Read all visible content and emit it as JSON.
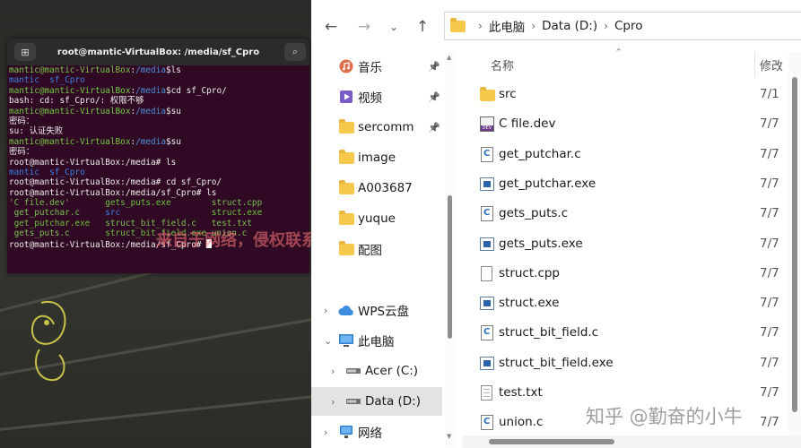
{
  "terminal": {
    "title": "root@mantic-VirtualBox: /media/sf_Cpro",
    "lines": [
      [
        {
          "t": "mantic@mantic-VirtualBox",
          "c": "p-user"
        },
        {
          "t": ":",
          "c": ""
        },
        {
          "t": "/media",
          "c": "p-path"
        },
        {
          "t": "$ls",
          "c": ""
        }
      ],
      [
        {
          "t": "mantic  sf_Cpro",
          "c": "dirc"
        }
      ],
      [
        {
          "t": "mantic@mantic-VirtualBox",
          "c": "p-user"
        },
        {
          "t": ":",
          "c": ""
        },
        {
          "t": "/media",
          "c": "p-path"
        },
        {
          "t": "$cd sf_Cpro/",
          "c": ""
        }
      ],
      [
        {
          "t": "bash: cd: sf_Cpro/: 权限不够",
          "c": ""
        }
      ],
      [
        {
          "t": "mantic@mantic-VirtualBox",
          "c": "p-user"
        },
        {
          "t": ":",
          "c": ""
        },
        {
          "t": "/media",
          "c": "p-path"
        },
        {
          "t": "$su",
          "c": ""
        }
      ],
      [
        {
          "t": "密码：",
          "c": ""
        }
      ],
      [
        {
          "t": "su: 认证失败",
          "c": ""
        }
      ],
      [
        {
          "t": "mantic@mantic-VirtualBox",
          "c": "p-user"
        },
        {
          "t": ":",
          "c": ""
        },
        {
          "t": "/media",
          "c": "p-path"
        },
        {
          "t": "$su",
          "c": ""
        }
      ],
      [
        {
          "t": "密码：",
          "c": ""
        }
      ],
      [
        {
          "t": "root@mantic-VirtualBox:/media# ls",
          "c": ""
        }
      ],
      [
        {
          "t": "mantic  sf_Cpro",
          "c": "dirc"
        }
      ],
      [
        {
          "t": "root@mantic-VirtualBox:/media# cd sf_Cpro/",
          "c": ""
        }
      ],
      [
        {
          "t": "root@mantic-VirtualBox:/media/sf_Cpro# ls",
          "c": ""
        }
      ],
      [
        {
          "t": "'C file.dev'       ",
          "c": "src"
        },
        {
          "t": "gets_puts.exe        ",
          "c": "exec"
        },
        {
          "t": "struct.cpp",
          "c": "src"
        }
      ],
      [
        {
          "t": " get_putchar.c     ",
          "c": "src"
        },
        {
          "t": "src                  ",
          "c": "dirc"
        },
        {
          "t": "struct.exe",
          "c": "exec"
        }
      ],
      [
        {
          "t": " get_putchar.exe   ",
          "c": "exec"
        },
        {
          "t": "struct_bit_field.c   ",
          "c": "src"
        },
        {
          "t": "test.txt",
          "c": "src"
        }
      ],
      [
        {
          "t": " gets_puts.c       ",
          "c": "src"
        },
        {
          "t": "struct_bit_field.exe ",
          "c": "exec"
        },
        {
          "t": "union.c",
          "c": "src"
        }
      ],
      [
        {
          "t": "root@mantic-VirtualBox:/media/sf_Cpro# ",
          "c": ""
        }
      ]
    ]
  },
  "watermark_cn": "来自于网络，侵权联系站长删除！",
  "explorer": {
    "breadcrumb": [
      "此电脑",
      "Data (D:)",
      "Cpro"
    ],
    "nav_items": [
      {
        "label": "音乐",
        "icon": "music-icon",
        "pinned": true
      },
      {
        "label": "视频",
        "icon": "video-icon",
        "pinned": true
      },
      {
        "label": "sercomm",
        "icon": "folder-icon",
        "pinned": true
      },
      {
        "label": "image",
        "icon": "folder-icon",
        "pinned": false
      },
      {
        "label": "A003687",
        "icon": "folder-icon",
        "pinned": false
      },
      {
        "label": "yuque",
        "icon": "folder-icon",
        "pinned": false
      },
      {
        "label": "配图",
        "icon": "folder-icon",
        "pinned": false
      },
      {
        "label": "WPS云盘",
        "icon": "cloud-icon",
        "pinned": false
      },
      {
        "label": "此电脑",
        "icon": "computer-icon",
        "pinned": false
      },
      {
        "label": "Acer (C:)",
        "icon": "drive-icon",
        "pinned": false
      },
      {
        "label": "Data (D:)",
        "icon": "drive-icon",
        "pinned": false
      },
      {
        "label": "网络",
        "icon": "network-icon",
        "pinned": false
      }
    ],
    "columns": {
      "name": "名称",
      "date": "修改"
    },
    "files": [
      {
        "name": "src",
        "type": "folder",
        "date": "7/1"
      },
      {
        "name": "C file.dev",
        "type": "dev",
        "date": "7/7"
      },
      {
        "name": "get_putchar.c",
        "type": "c",
        "date": "7/7"
      },
      {
        "name": "get_putchar.exe",
        "type": "exe",
        "date": "7/7"
      },
      {
        "name": "gets_puts.c",
        "type": "c",
        "date": "7/7"
      },
      {
        "name": "gets_puts.exe",
        "type": "exe",
        "date": "7/7"
      },
      {
        "name": "struct.cpp",
        "type": "blank",
        "date": "7/7"
      },
      {
        "name": "struct.exe",
        "type": "exe",
        "date": "7/7"
      },
      {
        "name": "struct_bit_field.c",
        "type": "c",
        "date": "7/7"
      },
      {
        "name": "struct_bit_field.exe",
        "type": "exe",
        "date": "7/7"
      },
      {
        "name": "test.txt",
        "type": "txt",
        "date": "7/7"
      },
      {
        "name": "union.c",
        "type": "c",
        "date": "7/7"
      }
    ]
  },
  "zhihu_watermark": "知乎 @勤奋的小牛"
}
